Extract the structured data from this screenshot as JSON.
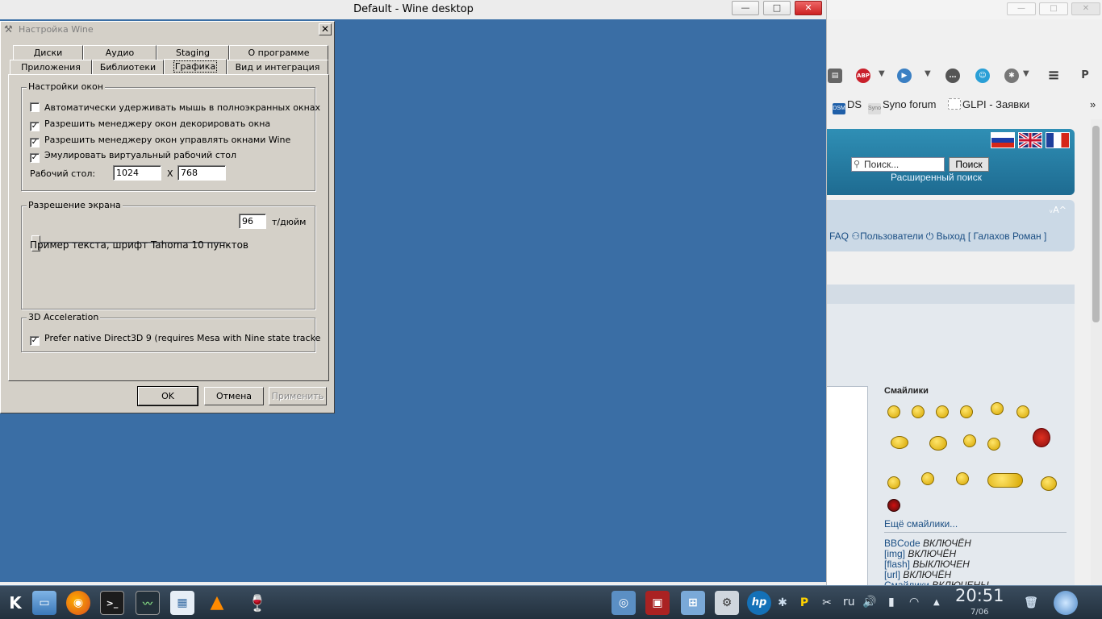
{
  "wine_window": {
    "title": "Default - Wine desktop",
    "min_label": "—",
    "max_label": "□",
    "close_label": "✕"
  },
  "dialog": {
    "title": "Настройка Wine",
    "close_label": "✕",
    "tabs_row1": [
      "Диски",
      "Аудио",
      "Staging",
      "О программе"
    ],
    "tabs_row2": [
      "Приложения",
      "Библиотеки",
      "Графика",
      "Вид и интеграция"
    ],
    "active_tab": "Графика",
    "window_settings": {
      "title": "Настройки окон",
      "options": [
        {
          "label": "Автоматически удерживать мышь в полноэкранных окнах",
          "checked": false
        },
        {
          "label": "Разрешить менеджеру окон декорировать окна",
          "checked": true
        },
        {
          "label": "Разрешить менеджеру окон управлять окнами Wine",
          "checked": true
        },
        {
          "label": "Эмулировать виртуальный рабочий стол",
          "checked": true
        }
      ],
      "desktop_label": "Рабочий стол:",
      "desktop_width": "1024",
      "x_label": "X",
      "desktop_height": "768"
    },
    "resolution": {
      "title": "Разрешение экрана",
      "dpi_value": "96",
      "dpi_unit": "т/дюйм",
      "sample_text": "Пример текста, шрифт Tahoma 10 пунктов"
    },
    "accel": {
      "title": "3D Acceleration",
      "option": "Prefer native Direct3D 9 (requires Mesa with Nine state tracke",
      "checked": true
    },
    "buttons": {
      "ok": "OK",
      "cancel": "Отмена",
      "apply": "Применить"
    }
  },
  "browser": {
    "toolbar_icons": [
      "abp-icon",
      "play-icon",
      "chat-icon",
      "ghost-icon",
      "gear-icon",
      "menu-icon"
    ],
    "abp_label": "ABP",
    "bookmarks": [
      {
        "icon": "DSM",
        "label": "DS"
      },
      {
        "icon": "Syno",
        "label": "Syno forum"
      },
      {
        "icon": "",
        "label": "GLPI - Заявки"
      }
    ],
    "overflow": "»",
    "search_placeholder": "Поиск...",
    "search_button": "Поиск",
    "advanced_search": "Расширенный поиск",
    "font_controls": "ᵥA^",
    "nav_faq": "FAQ",
    "nav_users": "Пользователи",
    "nav_logout": "Выход [ Галахов Роман ]",
    "smileys_title": "Смайлики",
    "more_smileys": "Ещё смайлики...",
    "bbcode": [
      {
        "label": "BBCode",
        "state": "ВКЛЮЧЁН"
      },
      {
        "label": "[img]",
        "state": "ВКЛЮЧЁН"
      },
      {
        "label": "[flash]",
        "state": "ВЫКЛЮЧЕН"
      },
      {
        "label": "[url]",
        "state": "ВКЛЮЧЁН"
      },
      {
        "label": "Смайлики",
        "state": "ВКЛЮЧЕНЫ"
      }
    ]
  },
  "taskbar": {
    "lang": "ru",
    "time": "20:51",
    "date": "7/06"
  },
  "colors": {
    "desktop": "#3a6ea5",
    "dialog_face": "#d4d0c8",
    "taskbar": "#2c3a48",
    "forum_header": "#2a85ab"
  }
}
